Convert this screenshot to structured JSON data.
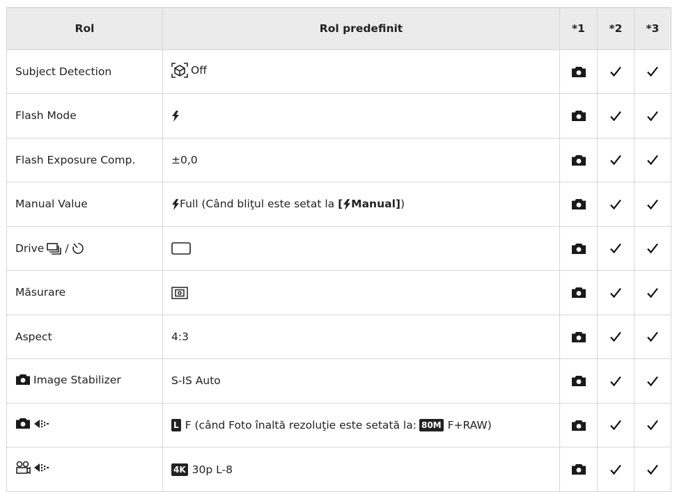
{
  "header": {
    "col_role": "Rol",
    "col_default": "Rol predefinit",
    "col_n1": "*1",
    "col_n2": "*2",
    "col_n3": "*3"
  },
  "rows": [
    {
      "role": "Subject Detection",
      "default_text": "Off"
    },
    {
      "role": "Flash Mode"
    },
    {
      "role": "Flash Exposure Comp.",
      "default_text": "±0,0"
    },
    {
      "role": "Manual Value",
      "default_a": "Full (Când bliţul este setat la ",
      "default_b": "[",
      "default_c": "Manual]",
      "default_d": ")"
    },
    {
      "role": "Drive",
      "role_sep": "/"
    },
    {
      "role": "Măsurare"
    },
    {
      "role": "Aspect",
      "default_text": "4:3"
    },
    {
      "role": "Image Stabilizer",
      "default_text": "S-IS Auto"
    },
    {
      "role": "",
      "default_badge": "L",
      "default_a": "F (când Foto înaltă rezoluţie este setată la: ",
      "default_badge2": "80M",
      "default_b": "F+RAW)"
    },
    {
      "role": "",
      "default_badge": "4K",
      "default_text": "30p L-8"
    }
  ],
  "check_mark": "✓"
}
